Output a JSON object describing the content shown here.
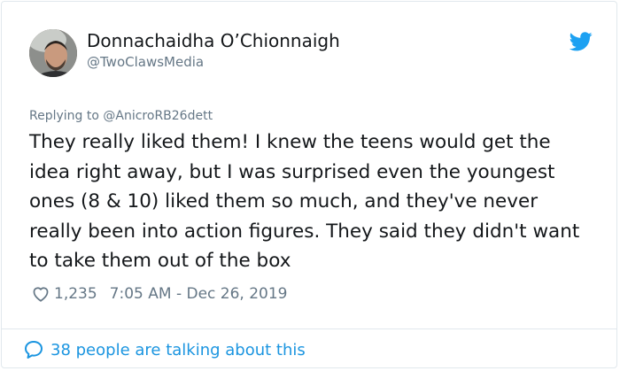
{
  "tweet": {
    "author_name": "Donnachaidha O’Chionnaigh",
    "author_handle": "@TwoClawsMedia",
    "replying_prefix": "Replying to",
    "replying_to": "@AnicroRB26dett",
    "text": "They really liked them! I knew the teens would get the idea right away, but I was surprised even the youngest ones (8 & 10) liked them so much, and they've never really been into action figures. They said they didn't want to take them out of the box",
    "like_count": "1,235",
    "timestamp": "7:05 AM - Dec 26, 2019",
    "talking_text": "38 people are talking about this"
  },
  "icons": {
    "brand": "twitter-bird-icon",
    "like": "heart-icon",
    "conversation": "speech-bubble-icon"
  },
  "colors": {
    "twitter_blue": "#1da1f2",
    "link_blue": "#1b95e0",
    "text_primary": "#14171a",
    "text_secondary": "#657786",
    "border": "#e1e8ed"
  }
}
